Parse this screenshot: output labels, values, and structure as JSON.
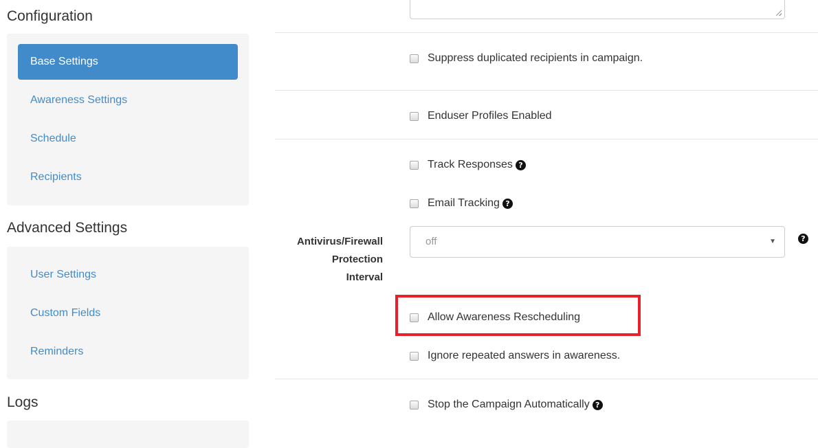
{
  "sidebar": {
    "configuration_title": "Configuration",
    "configuration_items": [
      {
        "label": "Base Settings",
        "active": true
      },
      {
        "label": "Awareness Settings",
        "active": false
      },
      {
        "label": "Schedule",
        "active": false
      },
      {
        "label": "Recipients",
        "active": false
      }
    ],
    "advanced_title": "Advanced Settings",
    "advanced_items": [
      {
        "label": "User Settings"
      },
      {
        "label": "Custom Fields"
      },
      {
        "label": "Reminders"
      }
    ],
    "logs_title": "Logs"
  },
  "form": {
    "suppress_duplicates_label": "Suppress duplicated recipients in campaign.",
    "enduser_profiles_label": "Enduser Profiles Enabled",
    "track_responses_label": "Track Responses",
    "email_tracking_label": "Email Tracking",
    "av_interval_label_line1": "Antivirus/Firewall",
    "av_interval_label_line2": "Protection",
    "av_interval_label_line3": "Interval",
    "av_interval_value": "off",
    "allow_rescheduling_label": "Allow Awareness Rescheduling",
    "ignore_repeated_label": "Ignore repeated answers in awareness.",
    "stop_campaign_label": "Stop the Campaign Automatically"
  },
  "icons": {
    "help": "question-circle-icon",
    "select_arrow": "caret-down-icon",
    "help_glyph": "?",
    "arrow_glyph": "▼"
  },
  "colors": {
    "accent": "#428bca",
    "highlight": "#e8202a",
    "panel_bg": "#f5f5f5"
  }
}
